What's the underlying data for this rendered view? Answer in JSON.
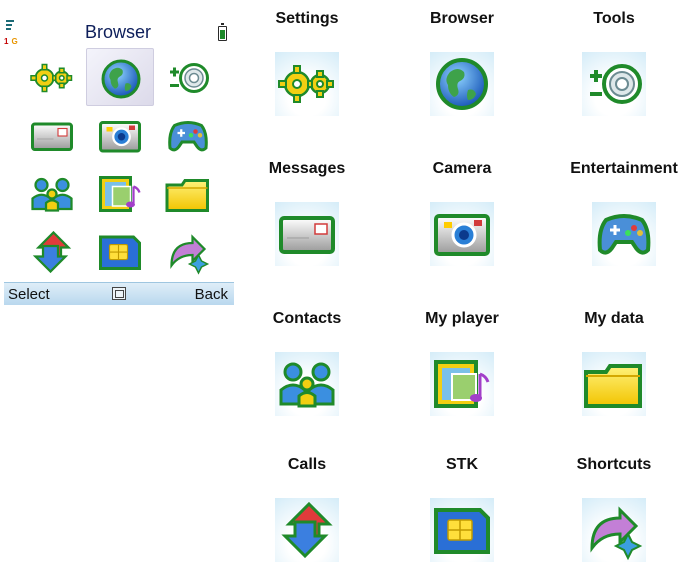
{
  "phone": {
    "title": "Browser",
    "status": {
      "line_indicator": "1",
      "network_indicator": "G"
    },
    "softkeys": {
      "left": "Select",
      "right": "Back"
    },
    "selected_item": "Browser",
    "grid": [
      [
        "Settings",
        "Browser",
        "Tools"
      ],
      [
        "Messages",
        "Camera",
        "Entertainment"
      ],
      [
        "Contacts",
        "My player",
        "My data"
      ],
      [
        "Calls",
        "STK",
        "Shortcuts"
      ]
    ]
  },
  "legend": {
    "items": [
      {
        "label": "Settings",
        "icon": "gears-icon"
      },
      {
        "label": "Browser",
        "icon": "globe-icon"
      },
      {
        "label": "Tools",
        "icon": "tools-icon"
      },
      {
        "label": "Messages",
        "icon": "envelope-icon"
      },
      {
        "label": "Camera",
        "icon": "camera-icon"
      },
      {
        "label": "Entertainment",
        "icon": "gamepad-icon"
      },
      {
        "label": "Contacts",
        "icon": "people-icon"
      },
      {
        "label": "My player",
        "icon": "film-music-icon"
      },
      {
        "label": "My data",
        "icon": "folder-icon"
      },
      {
        "label": "Calls",
        "icon": "call-arrows-icon"
      },
      {
        "label": "STK",
        "icon": "sim-card-icon"
      },
      {
        "label": "Shortcuts",
        "icon": "shortcut-arrow-icon"
      }
    ]
  },
  "colors": {
    "icon_outline": "#1f8a2a",
    "title_text": "#0d1e5a",
    "softbar": "#c8e2f3"
  }
}
